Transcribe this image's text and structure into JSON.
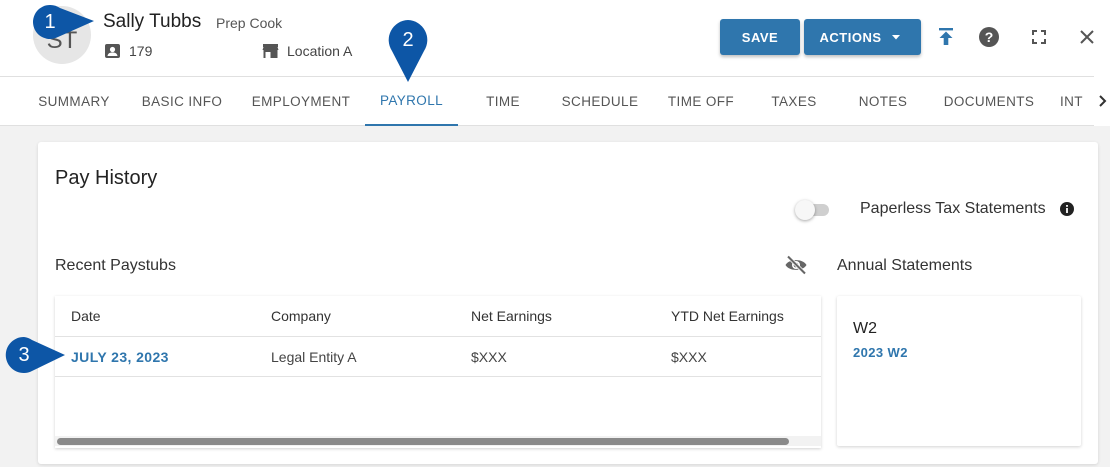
{
  "employee": {
    "initials": "ST",
    "name": "Sally Tubbs",
    "title": "Prep Cook",
    "id_number": "179",
    "location": "Location A"
  },
  "toolbar": {
    "save_label": "SAVE",
    "actions_label": "ACTIONS"
  },
  "tabs": [
    {
      "label": "SUMMARY"
    },
    {
      "label": "BASIC INFO"
    },
    {
      "label": "EMPLOYMENT"
    },
    {
      "label": "PAYROLL",
      "active": true
    },
    {
      "label": "TIME"
    },
    {
      "label": "SCHEDULE"
    },
    {
      "label": "TIME OFF"
    },
    {
      "label": "TAXES"
    },
    {
      "label": "NOTES"
    },
    {
      "label": "DOCUMENTS"
    },
    {
      "label": "INT"
    }
  ],
  "pay_history": {
    "title": "Pay History",
    "paperless_label": "Paperless Tax Statements",
    "paperless_enabled": false,
    "recent_label": "Recent Paystubs",
    "columns": [
      "Date",
      "Company",
      "Net Earnings",
      "YTD Net Earnings"
    ],
    "rows": [
      {
        "date": "JULY 23, 2023",
        "company": "Legal Entity A",
        "net": "$XXX",
        "ytd": "$XXX"
      }
    ]
  },
  "annual": {
    "label": "Annual Statements",
    "doc_title": "W2",
    "doc_link": "2023 W2"
  },
  "markers": [
    "1",
    "2",
    "3"
  ],
  "colors": {
    "primary": "#2f76ad",
    "marker": "#0d56a6",
    "background": "#f2f2f2"
  }
}
